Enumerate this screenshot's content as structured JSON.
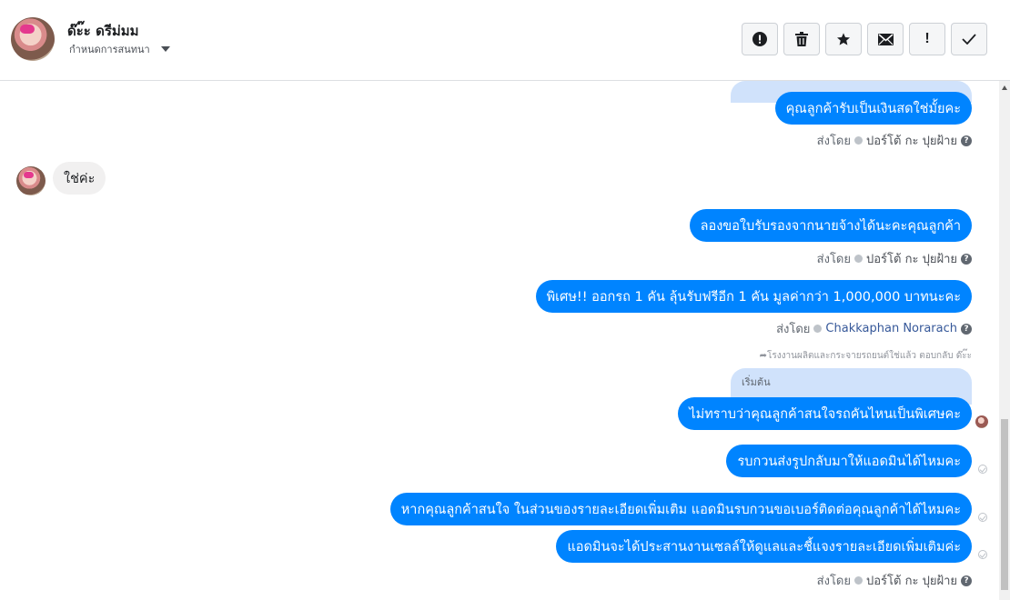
{
  "header": {
    "contact_name": "ด๊ะ๊ะ ดรีม่มม",
    "assign_label": "กำหนดการสนทนา",
    "toolbar": [
      {
        "icon": "alert-icon",
        "label": "Mark as spam"
      },
      {
        "icon": "trash-icon",
        "label": "Delete"
      },
      {
        "icon": "star-icon",
        "label": "Star"
      },
      {
        "icon": "mail-icon",
        "label": "Mark as unread"
      },
      {
        "icon": "follow-up-icon",
        "label": "Follow up"
      },
      {
        "icon": "checkmark-icon",
        "label": "Mark as done"
      }
    ]
  },
  "thread": {
    "messages": [
      {
        "id": "m1",
        "direction": "out",
        "text": "คุณลูกค้ารับเป็นเงินสดใช่มั้ยคะ"
      },
      {
        "id": "m2",
        "direction": "in",
        "text": "ใช่ค่ะ"
      },
      {
        "id": "m3",
        "direction": "out",
        "text": "ลองขอใบรับรองจากนายจ้างได้นะคะคุณลูกค้า"
      },
      {
        "id": "m4",
        "direction": "out",
        "text": "พิเศษ!! ออกรถ 1 คัน ลุ้นรับฟรีอีก 1 คัน มูลค่ากว่า 1,000,000 บาทนะคะ"
      },
      {
        "id": "m5",
        "direction": "out",
        "text": "ไม่ทราบว่าคุณลูกค้าสนใจรถคันไหนเป็นพิเศษคะ"
      },
      {
        "id": "m6",
        "direction": "out",
        "text": "รบกวนส่งรูปกลับมาให้แอดมินได้ไหมคะ"
      },
      {
        "id": "m7",
        "direction": "out",
        "text": "หากคุณลูกค้าสนใจ ในส่วนของรายละเอียดเพิ่มเติม แอดมินรบกวนขอเบอร์ติดต่อคุณลูกค้าได้ไหมคะ"
      },
      {
        "id": "m8",
        "direction": "out",
        "text": "แอดมินจะได้ประสานงานเซลล์ให้ดูแลและชี้แจงรายละเอียดเพิ่มเติมค่ะ"
      }
    ],
    "sent_by_prefix": "ส่งโดย",
    "sender_pore": "ปอร์โต้ กะ ปุยฝ้าย",
    "sender_chakkaphan": "Chakkaphan Norarach",
    "reply_note": "โรงงานผลิตและกระจายรถยนต์ใช่แล้ว ตอบกลับ ด๊ะ๊ะ",
    "quoted_label": "เริ่มต้น"
  }
}
